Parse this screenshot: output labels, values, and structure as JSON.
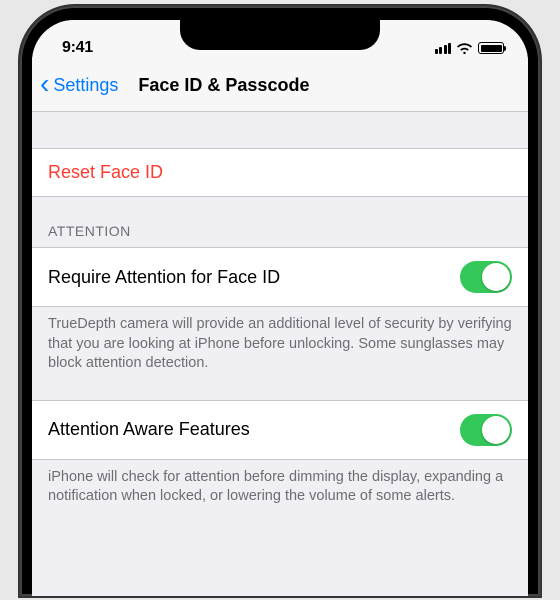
{
  "statusBar": {
    "time": "9:41"
  },
  "nav": {
    "back": "Settings",
    "title": "Face ID & Passcode"
  },
  "reset": {
    "label": "Reset Face ID"
  },
  "attention": {
    "header": "ATTENTION",
    "requireLabel": "Require Attention for Face ID",
    "requireFooter": "TrueDepth camera will provide an additional level of security by verifying that you are looking at iPhone before unlocking. Some sunglasses may block attention detection.",
    "awareLabel": "Attention Aware Features",
    "awareFooter": "iPhone will check for attention before dimming the display, expanding a notification when locked, or lowering the volume of some alerts."
  },
  "toggles": {
    "requireAttention": true,
    "attentionAware": true
  },
  "colors": {
    "tint": "#007aff",
    "destructive": "#ff3b30",
    "toggleOn": "#34c759"
  }
}
